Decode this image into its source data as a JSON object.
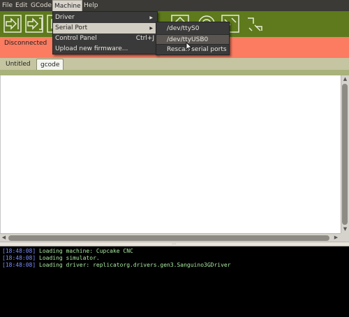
{
  "menubar": {
    "items": [
      "File",
      "Edit",
      "GCode",
      "Machine",
      "Help"
    ],
    "active": "Machine"
  },
  "toolbar": {
    "buttons": [
      "build-icon",
      "upload-icon",
      "stop-icon",
      "pause-icon",
      "extruder-icon",
      "connect-icon",
      "control-panel-icon",
      "disconnect-icon",
      "reset-icon"
    ]
  },
  "status": {
    "text": "Disconnected"
  },
  "tabs": [
    {
      "label": "Untitled"
    },
    {
      "label": "gcode"
    }
  ],
  "selected_tab": "gcode",
  "machine_menu": {
    "items": [
      {
        "label": "Driver",
        "submenu": true
      },
      {
        "label": "Serial Port",
        "submenu": true
      },
      {
        "label": "Control Panel",
        "shortcut": "Ctrl+J"
      },
      {
        "label": "Upload new firmware..."
      }
    ],
    "highlighted": "Serial Port"
  },
  "serial_menu": {
    "items": [
      {
        "label": "/dev/ttyS0"
      },
      {
        "label": "/dev/ttyUSB0"
      },
      {
        "label": "Rescan serial ports"
      }
    ],
    "highlighted": "/dev/ttyUSB0"
  },
  "console": {
    "lines": [
      {
        "time": "[18:48:08]",
        "text": "Loading machine: Cupcake CNC"
      },
      {
        "time": "[18:48:08]",
        "text": "Loading simulator."
      },
      {
        "time": "[18:48:08]",
        "text": "Loading driver: replicatorg.drivers.gen3.Sanguino3GDriver"
      }
    ]
  },
  "colors": {
    "toolbar": "#5e7a1c",
    "status_disconnected": "#fb7c61",
    "console_timestamp": "#7c8fff",
    "console_message": "#a8e9a0"
  }
}
